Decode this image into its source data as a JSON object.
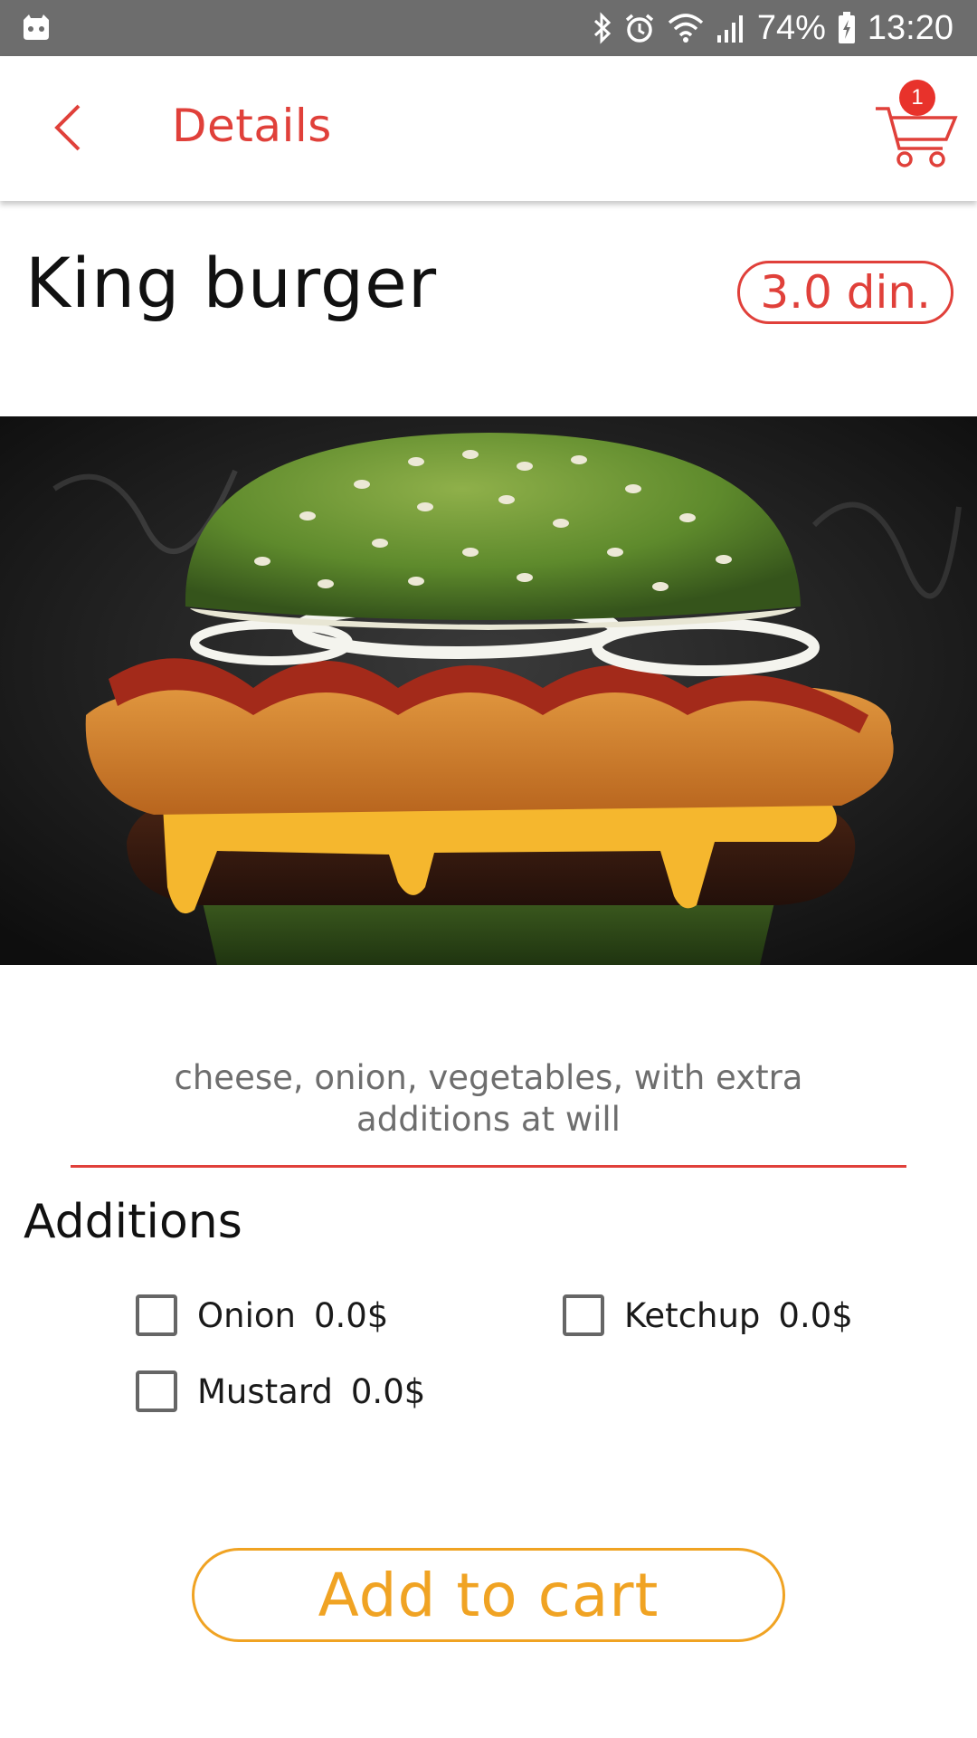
{
  "status_bar": {
    "left_icon": "android-notification-icon",
    "icons": [
      "bluetooth-icon",
      "alarm-icon",
      "wifi-icon",
      "signal-icon"
    ],
    "battery_percent": "74%",
    "battery_icon": "battery-charging-icon",
    "time": "13:20"
  },
  "app_bar": {
    "back_icon": "chevron-left-icon",
    "title": "Details",
    "cart_icon": "shopping-cart-icon",
    "cart_count": "1"
  },
  "product": {
    "name": "King burger",
    "price": "3.0 din.",
    "image": "burger-photo",
    "description": "cheese, onion, vegetables, with extra additions at will"
  },
  "additions": {
    "title": "Additions",
    "items": [
      {
        "label": "Onion",
        "price": "0.0$",
        "checked": false
      },
      {
        "label": "Ketchup",
        "price": "0.0$",
        "checked": false
      },
      {
        "label": "Mustard",
        "price": "0.0$",
        "checked": false
      }
    ]
  },
  "actions": {
    "add_to_cart_label": "Add to cart"
  },
  "colors": {
    "status_bar": "#6d6d6d",
    "accent_red": "#e0403a",
    "badge_red": "#e8322b",
    "button_orange": "#f0a323"
  }
}
